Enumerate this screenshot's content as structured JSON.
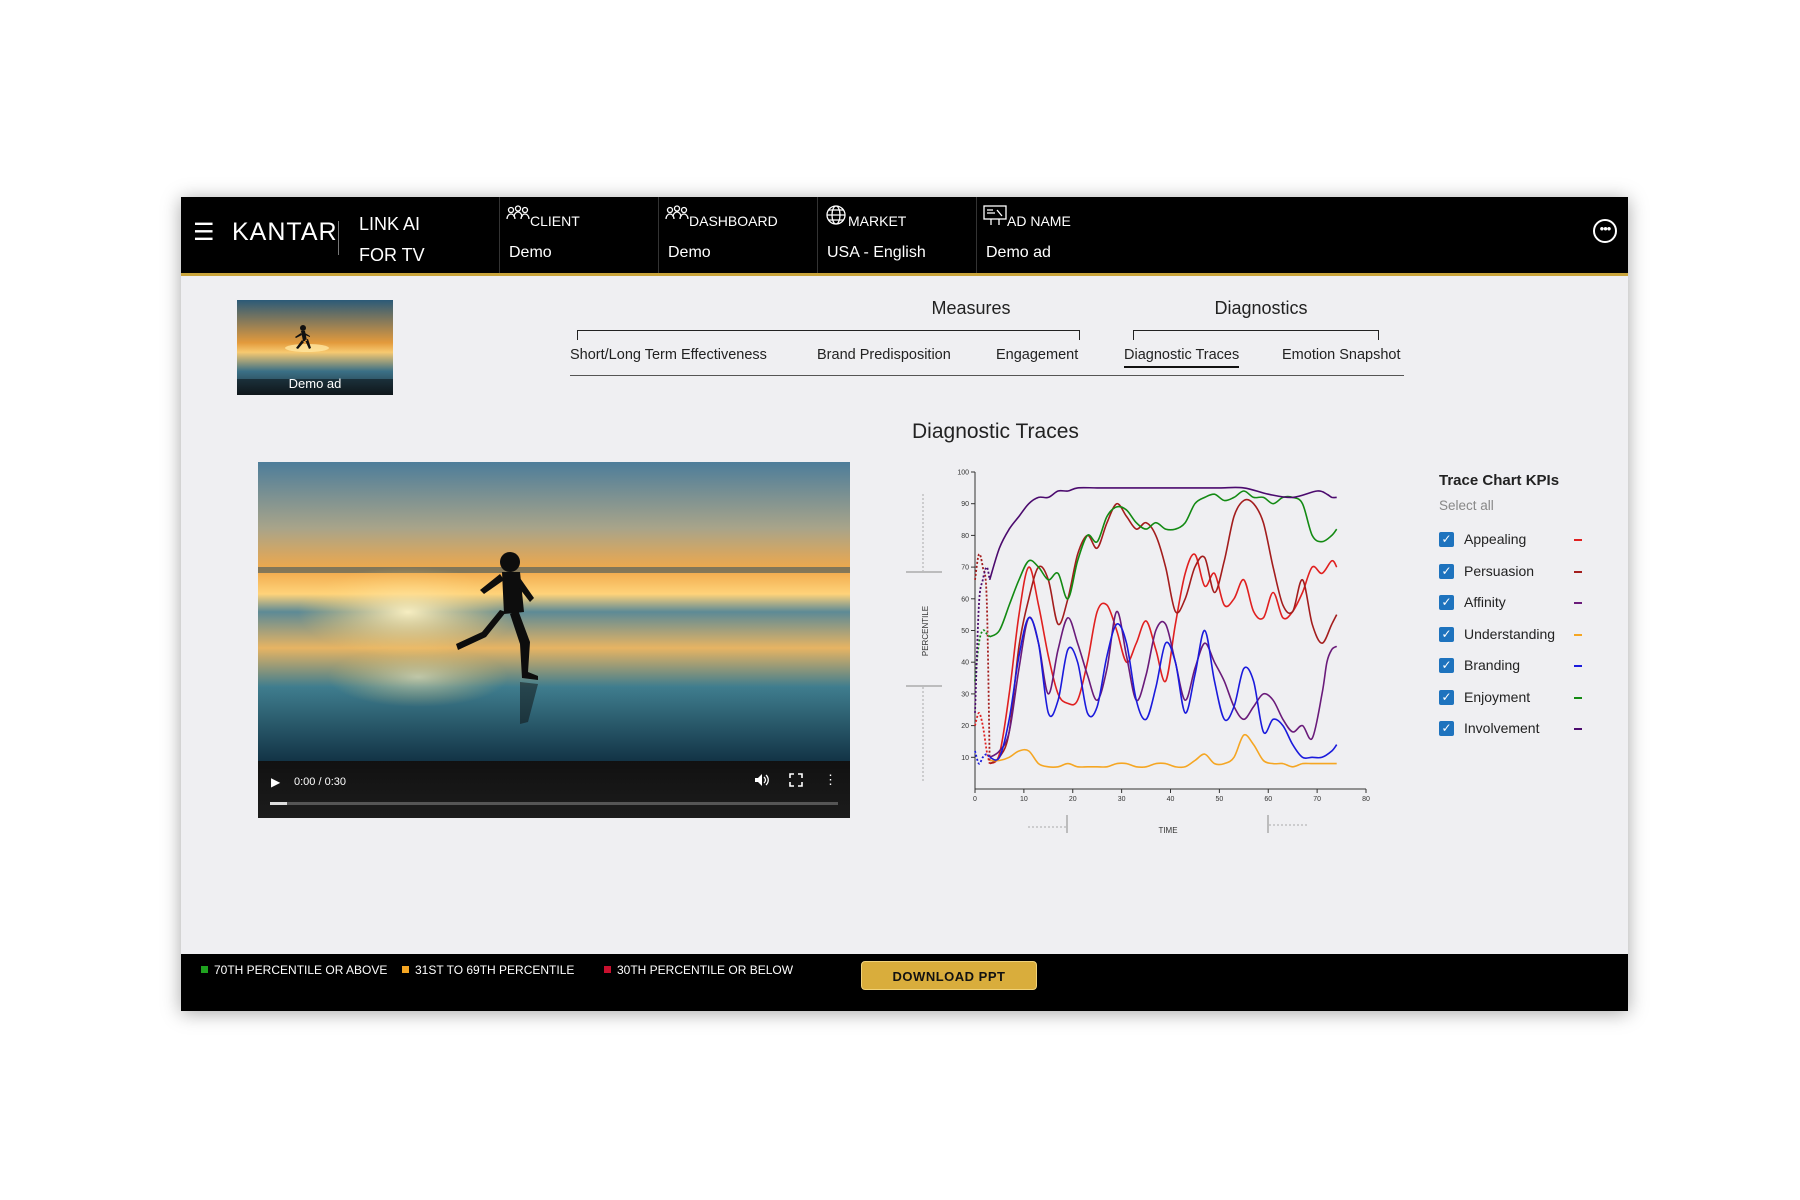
{
  "header": {
    "brand": "KANTAR",
    "product_line1": "LINK AI",
    "product_line2": "FOR TV",
    "segments": [
      {
        "label": "CLIENT",
        "value": "Demo",
        "icon": "people-icon"
      },
      {
        "label": "DASHBOARD",
        "value": "Demo",
        "icon": "people-icon"
      },
      {
        "label": "MARKET",
        "value": "USA - English",
        "icon": "globe-icon"
      },
      {
        "label": "AD NAME",
        "value": "Demo ad",
        "icon": "billboard-icon"
      }
    ],
    "more_icon": "more-icon"
  },
  "thumbnail": {
    "caption": "Demo ad"
  },
  "nav": {
    "groups": [
      "Measures",
      "Diagnostics"
    ],
    "tabs": [
      "Short/Long Term Effectiveness",
      "Brand Predisposition",
      "Engagement",
      "Diagnostic Traces",
      "Emotion Snapshot"
    ],
    "active_tab": "Diagnostic Traces"
  },
  "video": {
    "time": "0:00 / 0:30",
    "progress": 0.03
  },
  "chart_title": "Diagnostic Traces",
  "kpi": {
    "title": "Trace Chart KPIs",
    "select_all": "Select all",
    "items": [
      {
        "name": "Appealing",
        "color": "#e02020"
      },
      {
        "name": "Persuasion",
        "color": "#a31d1d"
      },
      {
        "name": "Affinity",
        "color": "#6a1b7a"
      },
      {
        "name": "Understanding",
        "color": "#f5a623"
      },
      {
        "name": "Branding",
        "color": "#1a1adc"
      },
      {
        "name": "Enjoyment",
        "color": "#138a13"
      },
      {
        "name": "Involvement",
        "color": "#4b0a6e"
      }
    ]
  },
  "chart_data": {
    "type": "line",
    "xlabel": "TIME",
    "ylabel": "PERCENTILE",
    "xlim": [
      0,
      80
    ],
    "ylim": [
      0,
      100
    ],
    "x_ticks": [
      0,
      10,
      20,
      30,
      40,
      50,
      60,
      70,
      80
    ],
    "y_ticks": [
      10,
      20,
      30,
      40,
      50,
      60,
      70,
      80,
      90,
      100
    ],
    "series": [
      {
        "name": "Appealing",
        "color": "#e02020",
        "x": [
          3,
          5,
          7,
          9,
          11,
          13,
          15,
          17,
          19,
          21,
          23,
          25,
          27,
          29,
          31,
          33,
          35,
          37,
          39,
          41,
          43,
          45,
          47,
          49,
          51,
          53,
          55,
          57,
          59,
          61,
          63,
          65,
          67,
          69,
          71,
          73,
          74
        ],
        "y": [
          8,
          11,
          30,
          55,
          70,
          58,
          42,
          30,
          27,
          28,
          40,
          56,
          58,
          50,
          40,
          46,
          53,
          44,
          34,
          52,
          68,
          74,
          64,
          68,
          58,
          60,
          66,
          56,
          54,
          62,
          54,
          56,
          62,
          70,
          68,
          72,
          70
        ]
      },
      {
        "name": "Persuasion",
        "color": "#a31d1d",
        "x": [
          3,
          5,
          7,
          9,
          11,
          13,
          15,
          17,
          19,
          21,
          23,
          25,
          27,
          29,
          31,
          33,
          35,
          37,
          39,
          41,
          43,
          45,
          47,
          49,
          51,
          53,
          55,
          57,
          59,
          61,
          63,
          65,
          67,
          69,
          71,
          73,
          74
        ],
        "y": [
          8,
          10,
          18,
          45,
          60,
          70,
          66,
          52,
          60,
          74,
          80,
          76,
          84,
          90,
          86,
          82,
          84,
          80,
          70,
          56,
          60,
          70,
          73,
          62,
          72,
          86,
          91,
          90,
          84,
          70,
          58,
          56,
          66,
          52,
          46,
          52,
          55
        ]
      },
      {
        "name": "Affinity",
        "color": "#6a1b7a",
        "x": [
          3,
          5,
          7,
          9,
          11,
          13,
          15,
          17,
          19,
          21,
          23,
          25,
          27,
          29,
          31,
          33,
          35,
          37,
          39,
          41,
          43,
          45,
          47,
          49,
          51,
          53,
          55,
          57,
          59,
          61,
          63,
          65,
          67,
          69,
          71,
          72,
          73,
          74
        ],
        "y": [
          10,
          12,
          18,
          38,
          54,
          46,
          30,
          44,
          54,
          46,
          36,
          28,
          38,
          56,
          42,
          28,
          36,
          50,
          52,
          40,
          28,
          38,
          46,
          40,
          34,
          26,
          22,
          26,
          30,
          28,
          22,
          18,
          20,
          16,
          30,
          40,
          44,
          45
        ]
      },
      {
        "name": "Understanding",
        "color": "#f5a623",
        "x": [
          3,
          5,
          7,
          9,
          11,
          13,
          15,
          17,
          19,
          21,
          23,
          25,
          27,
          29,
          31,
          33,
          35,
          37,
          39,
          41,
          43,
          45,
          47,
          49,
          51,
          53,
          55,
          57,
          59,
          61,
          63,
          65,
          67,
          69,
          71,
          73,
          74
        ],
        "y": [
          9,
          9,
          10,
          12,
          12,
          8,
          7,
          7,
          8,
          7,
          7,
          7,
          7,
          8,
          8,
          7,
          7,
          8,
          8,
          7,
          7,
          9,
          11,
          8,
          8,
          10,
          17,
          14,
          9,
          8,
          8,
          7,
          8,
          8,
          8,
          8,
          8
        ]
      },
      {
        "name": "Branding",
        "color": "#1a1adc",
        "x": [
          3,
          5,
          7,
          9,
          11,
          13,
          15,
          17,
          19,
          21,
          23,
          25,
          27,
          29,
          31,
          33,
          35,
          37,
          39,
          41,
          43,
          45,
          47,
          49,
          51,
          53,
          55,
          57,
          59,
          61,
          63,
          65,
          67,
          69,
          71,
          73,
          74
        ],
        "y": [
          10,
          10,
          22,
          42,
          54,
          46,
          24,
          28,
          44,
          40,
          24,
          26,
          42,
          52,
          46,
          28,
          22,
          32,
          46,
          40,
          24,
          36,
          50,
          34,
          22,
          26,
          38,
          34,
          18,
          22,
          20,
          14,
          10,
          10,
          10,
          12,
          14
        ]
      },
      {
        "name": "Enjoyment",
        "color": "#138a13",
        "x": [
          3,
          5,
          7,
          9,
          11,
          13,
          15,
          17,
          19,
          21,
          23,
          25,
          27,
          29,
          31,
          33,
          35,
          37,
          39,
          41,
          43,
          45,
          47,
          49,
          51,
          53,
          55,
          57,
          59,
          61,
          63,
          65,
          67,
          69,
          71,
          73,
          74
        ],
        "y": [
          48,
          50,
          58,
          66,
          72,
          70,
          66,
          68,
          60,
          72,
          80,
          78,
          86,
          89,
          88,
          84,
          82,
          84,
          82,
          82,
          84,
          90,
          92,
          93,
          91,
          92,
          94,
          92,
          92,
          90,
          92,
          92,
          90,
          80,
          78,
          80,
          82
        ]
      },
      {
        "name": "Involvement",
        "color": "#4b0a6e",
        "x": [
          3,
          5,
          7,
          9,
          11,
          13,
          15,
          17,
          19,
          21,
          25,
          30,
          35,
          40,
          45,
          50,
          55,
          60,
          65,
          70,
          72,
          73,
          74
        ],
        "y": [
          66,
          76,
          82,
          86,
          90,
          92,
          92,
          94,
          94,
          95,
          95,
          95,
          95,
          95,
          95,
          95,
          95,
          93,
          92,
          94,
          93,
          92,
          92
        ]
      }
    ],
    "dashed_starts": [
      {
        "color": "#e02020",
        "x": [
          0,
          0.8,
          1.6,
          2.4,
          3
        ],
        "y": [
          20,
          24,
          20,
          12,
          8
        ]
      },
      {
        "color": "#a31d1d",
        "x": [
          0,
          0.8,
          1.6,
          2.4,
          3
        ],
        "y": [
          66,
          74,
          70,
          60,
          8
        ]
      },
      {
        "color": "#138a13",
        "x": [
          0,
          0.8,
          1.6,
          2.4,
          3
        ],
        "y": [
          34,
          46,
          50,
          49,
          48
        ]
      },
      {
        "color": "#4b0a6e",
        "x": [
          0,
          0.8,
          1.6,
          2.4,
          3
        ],
        "y": [
          24,
          58,
          66,
          70,
          66
        ]
      },
      {
        "color": "#1a1adc",
        "x": [
          0,
          0.8,
          1.6,
          2.4,
          3
        ],
        "y": [
          12,
          8,
          10,
          11,
          10
        ]
      }
    ]
  },
  "footer": {
    "legend": [
      {
        "label": "70TH PERCENTILE OR ABOVE",
        "color": "#1fa21f"
      },
      {
        "label": "31ST TO 69TH PERCENTILE",
        "color": "#f5a623"
      },
      {
        "label": "30TH PERCENTILE OR BELOW",
        "color": "#c8102e"
      }
    ],
    "download_label": "DOWNLOAD PPT"
  }
}
